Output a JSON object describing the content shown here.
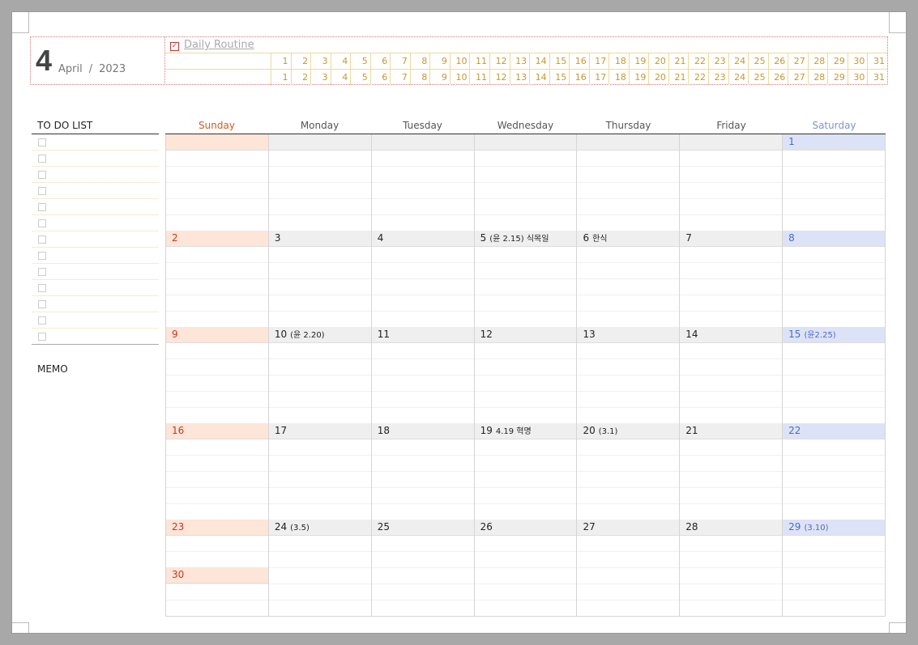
{
  "header": {
    "day_number": "4",
    "month": "April",
    "separator": "/",
    "year": "2023",
    "routine_title": "Daily Routine",
    "routine_check": "☑",
    "routine_days": [
      "1",
      "2",
      "3",
      "4",
      "5",
      "6",
      "7",
      "8",
      "9",
      "10",
      "11",
      "12",
      "13",
      "14",
      "15",
      "16",
      "17",
      "18",
      "19",
      "20",
      "21",
      "22",
      "23",
      "24",
      "25",
      "26",
      "27",
      "28",
      "29",
      "30",
      "31"
    ]
  },
  "todo": {
    "title": "TO DO LIST",
    "item_count": 13
  },
  "memo": {
    "title": "MEMO"
  },
  "calendar": {
    "weekdays": [
      "Sunday",
      "Monday",
      "Tuesday",
      "Wednesday",
      "Thursday",
      "Friday",
      "Saturday"
    ],
    "weeks": [
      [
        {
          "d": "",
          "n": ""
        },
        {
          "d": "",
          "n": ""
        },
        {
          "d": "",
          "n": ""
        },
        {
          "d": "",
          "n": ""
        },
        {
          "d": "",
          "n": ""
        },
        {
          "d": "",
          "n": ""
        },
        {
          "d": "1",
          "n": ""
        }
      ],
      [
        {
          "d": "2",
          "n": ""
        },
        {
          "d": "3",
          "n": ""
        },
        {
          "d": "4",
          "n": ""
        },
        {
          "d": "5",
          "n": "(윤 2.15) 식목일"
        },
        {
          "d": "6",
          "n": "한식"
        },
        {
          "d": "7",
          "n": ""
        },
        {
          "d": "8",
          "n": ""
        }
      ],
      [
        {
          "d": "9",
          "n": ""
        },
        {
          "d": "10",
          "n": "(윤 2.20)"
        },
        {
          "d": "11",
          "n": ""
        },
        {
          "d": "12",
          "n": ""
        },
        {
          "d": "13",
          "n": ""
        },
        {
          "d": "14",
          "n": ""
        },
        {
          "d": "15",
          "n": "(윤2.25)"
        }
      ],
      [
        {
          "d": "16",
          "n": ""
        },
        {
          "d": "17",
          "n": ""
        },
        {
          "d": "18",
          "n": ""
        },
        {
          "d": "19",
          "n": "4.19 혁명"
        },
        {
          "d": "20",
          "n": "(3.1)"
        },
        {
          "d": "21",
          "n": ""
        },
        {
          "d": "22",
          "n": ""
        }
      ],
      [
        {
          "d": "23",
          "n": ""
        },
        {
          "d": "24",
          "n": "(3.5)"
        },
        {
          "d": "25",
          "n": ""
        },
        {
          "d": "26",
          "n": ""
        },
        {
          "d": "27",
          "n": ""
        },
        {
          "d": "28",
          "n": ""
        },
        {
          "d": "29",
          "n": "(3.10)"
        }
      ]
    ],
    "extra_sunday": {
      "d": "30",
      "n": ""
    }
  },
  "colors": {
    "sunday": "#c8361e",
    "saturday": "#4a6cc0",
    "routine_accent": "#c9962e"
  }
}
